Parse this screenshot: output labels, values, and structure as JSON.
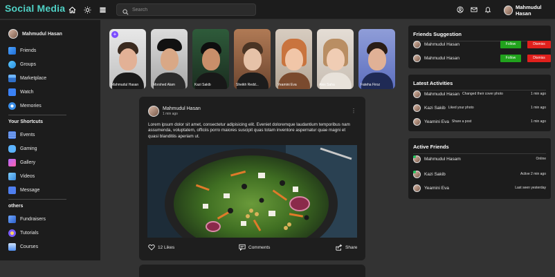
{
  "topbar": {
    "logo": "Social Media",
    "search_placeholder": "Search",
    "user_name": "Mahmudul Hasan"
  },
  "sidebar": {
    "profile_name": "Mahmudul Hasan",
    "menu": [
      {
        "label": "Friends",
        "icon": "friends-icon"
      },
      {
        "label": "Groups",
        "icon": "groups-icon"
      },
      {
        "label": "Marketplace",
        "icon": "marketplace-icon"
      },
      {
        "label": "Watch",
        "icon": "watch-icon"
      },
      {
        "label": "Memories",
        "icon": "memories-icon"
      }
    ],
    "shortcuts_heading": "Your Shortcuts",
    "shortcuts": [
      {
        "label": "Events",
        "icon": "events-icon"
      },
      {
        "label": "Gaming",
        "icon": "gaming-icon"
      },
      {
        "label": "Gallery",
        "icon": "gallery-icon"
      },
      {
        "label": "Videos",
        "icon": "videos-icon"
      },
      {
        "label": "Message",
        "icon": "message-icon"
      }
    ],
    "others_heading": "others",
    "others": [
      {
        "label": "Fundraisers",
        "icon": "fundraisers-icon"
      },
      {
        "label": "Tutorials",
        "icon": "tutorials-icon"
      },
      {
        "label": "Courses",
        "icon": "courses-icon"
      }
    ]
  },
  "stories": [
    {
      "name": "Mahmudul Hasan"
    },
    {
      "name": "Morshed Alam"
    },
    {
      "name": "Kazi Sakib"
    },
    {
      "name": "Sheikh Redd..."
    },
    {
      "name": "Yeamini Eva"
    },
    {
      "name": "Alex Saha"
    },
    {
      "name": "Fateha Firoz"
    }
  ],
  "post": {
    "author": "Mahmudul Hasan",
    "time": "1 min ago",
    "text": "Lorem ipsum dolor sit amet, consectetur adipisicing elit. Eveniet doloremque laudantium temporibus nam assumenda, voluptatem, officiis porro maiores suscipit quas totam inventore aspernatur quae magni et quasi blanditiis aperiam ut.",
    "likes": "12 Likes",
    "comments": "Comments",
    "share": "Share"
  },
  "friend_suggestions": {
    "title": "Friends Suggestion",
    "follow_label": "Follow",
    "dismiss_label": "Dismiss",
    "items": [
      {
        "name": "Mahmudul Hasan"
      },
      {
        "name": "Mahmudul Hasan"
      }
    ]
  },
  "latest_activities": {
    "title": "Latest Activities",
    "items": [
      {
        "name": "Mahmudul Hasan",
        "action": "Changed their cover photo",
        "time": "1 min ago"
      },
      {
        "name": "Kazi Sakib",
        "action": "Liked your photo",
        "time": "1 min ago"
      },
      {
        "name": "Yeamini Eva",
        "action": "Share a post",
        "time": "1 min ago"
      }
    ]
  },
  "active_friends": {
    "title": "Active Friends",
    "items": [
      {
        "name": "Mahmudul Hasam",
        "status": "Online"
      },
      {
        "name": "Kazi Sakib",
        "status": "Active 2 min ago"
      },
      {
        "name": "Yeamini Eva",
        "status": "Last seen yesterday"
      }
    ]
  },
  "colors": {
    "accent": "#4fd1c5",
    "follow": "#21a21d",
    "dismiss": "#e0201c",
    "add_story": "#7c4dff",
    "online": "#22c55e"
  }
}
